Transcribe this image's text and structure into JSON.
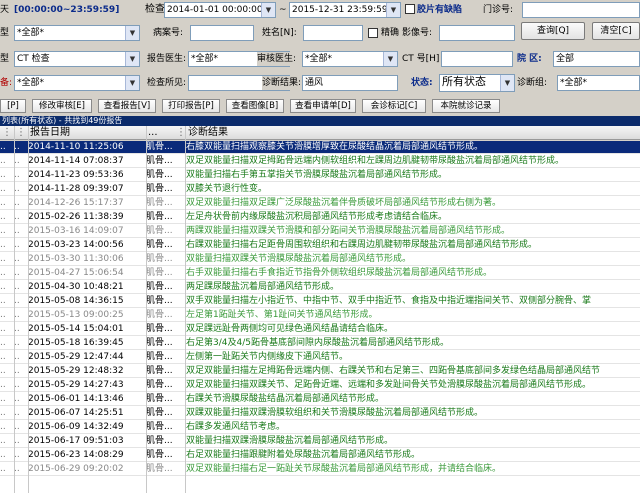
{
  "filters": {
    "row1": {
      "partial_label": "天",
      "time_range": "[00:00:00~23:59:59]",
      "check_time_label": "检查时间:",
      "date_from": "2014-01-01 00:00:00",
      "tilde": "~",
      "date_to": "2015-12-31 23:59:59",
      "film_label": "胶片有缺陷",
      "clinic_label": "门诊号:"
    },
    "row2": {
      "type_label": "型",
      "type_value": "*全部*",
      "case_label": "病案号:",
      "name_label": "姓名[N]:",
      "exact_label": "精确",
      "image_no_label": "影像号:",
      "query_button": "查询[Q]",
      "clear_button": "清空[C]"
    },
    "row3": {
      "type_label": "型",
      "type_value": "CT 检查",
      "report_doctor_label": "报告医生:",
      "report_doctor_value": "*全部*",
      "review_doctor_label": "审核医生:",
      "review_doctor_value": "*全部*",
      "ct_label": "CT 号[H]",
      "ward_label": "院 区:",
      "ward_value": "全部"
    },
    "row4": {
      "device_label": "备:",
      "device_value": "*全部*",
      "findings_label": "检查所见:",
      "diagnosis_label": "诊断结果:",
      "diagnosis_value": "通风",
      "status_label": "状态:",
      "status_value": "所有状态",
      "diag_group_label": "诊断组:",
      "diag_group_value": "*全部*"
    }
  },
  "toolbar": {
    "cut_label": "[P]",
    "buttons": [
      "修改审核[E]",
      "查看报告[V]",
      "打印报告[P]",
      "查看图像[B]",
      "查看申请单[D]",
      "会诊标记[C]",
      "本院就诊记录"
    ]
  },
  "status_text": "列表(所有状态) - 共找到49份报告",
  "table": {
    "col_date": "报告日期",
    "col_dots": "...",
    "col_diag": "诊断结果",
    "rows": [
      {
        "m1": "..",
        "m2": "..",
        "date": "2014-11-10 11:25:06",
        "part": "肌骨...",
        "diag": "右膝双能量扫描观察膝关节滑膜增厚致在尿酸结晶沉着局部通风结节形成。",
        "style": "sel"
      },
      {
        "m1": "..",
        "m2": "..",
        "date": "2014-11-14 07:08:37",
        "part": "肌骨...",
        "diag": "双足双能量扫描双足拇跖骨远端内侧软组织和左踝周边肌腱韧带尿酸盐沉着局部通风结节形成。",
        "style": ""
      },
      {
        "m1": "..",
        "m2": "..",
        "date": "2014-11-23 09:53:36",
        "part": "肌骨...",
        "diag": "双能量扫描右手第五掌指关节滑膜尿酸盐沉着局部通风结节形成。",
        "style": ""
      },
      {
        "m1": "..",
        "m2": "..",
        "date": "2014-11-28 09:39:07",
        "part": "肌骨...",
        "diag": "双膝关节退行性变。",
        "style": ""
      },
      {
        "m1": "..",
        "m2": "..",
        "date": "2014-12-26 15:17:37",
        "part": "肌骨...",
        "diag": "双足双能量扫描双足踝广泛尿酸盐沉着伴骨质破坏局部通风结节形成右侧为著。",
        "style": "gr gl"
      },
      {
        "m1": "..",
        "m2": "..",
        "date": "2015-02-26 11:38:39",
        "part": "肌骨...",
        "diag": "左足舟状骨前内缘尿酸盐沉积局部通风结节形成考虑请结合临床。",
        "style": ""
      },
      {
        "m1": "..",
        "m2": "..",
        "date": "2015-03-16 14:09:07",
        "part": "肌骨...",
        "diag": "两踝双能量扫描双踝关节滑膜和部分跖间关节滑膜尿酸盐沉着局部通风结节形成。",
        "style": "gr gl"
      },
      {
        "m1": "..",
        "m2": "..",
        "date": "2015-03-23 14:00:56",
        "part": "肌骨...",
        "diag": "右踝双能量扫描右足距骨周围软组织和右踝周边肌腱韧带尿酸盐沉着局部通风结节形成。",
        "style": ""
      },
      {
        "m1": "..",
        "m2": "..",
        "date": "2015-03-30 11:30:06",
        "part": "肌骨...",
        "diag": "双能量扫描双踝关节滑膜尿酸盐沉着局部通风结节形成。",
        "style": "gr gl"
      },
      {
        "m1": "..",
        "m2": "..",
        "date": "2015-04-27 15:06:54",
        "part": "肌骨...",
        "diag": "右手双能量扫描右手食指近节指骨外侧软组织尿酸盐沉着局部通风结节形成。",
        "style": "gr gl"
      },
      {
        "m1": "..",
        "m2": "..",
        "date": "2015-04-30 10:48:21",
        "part": "肌骨...",
        "diag": "两足踝尿酸盐沉着局部通风结节形成。",
        "style": ""
      },
      {
        "m1": "..",
        "m2": "..",
        "date": "2015-05-08 14:36:15",
        "part": "肌骨...",
        "diag": "双手双能量扫描左小指近节、中指中节、双手中指近节、食指及中指近端指间关节、双侧部分腕骨、掌",
        "style": ""
      },
      {
        "m1": "..",
        "m2": "..",
        "date": "2015-05-13 09:00:25",
        "part": "肌骨...",
        "diag": "左足第1跖趾关节、第1趾间关节通风结节形成。",
        "style": "gr gl"
      },
      {
        "m1": "..",
        "m2": "..",
        "date": "2015-05-14 15:04:01",
        "part": "肌骨...",
        "diag": "双足踝远趾骨两侧均可见绿色通风结晶请结合临床。",
        "style": ""
      },
      {
        "m1": "..",
        "m2": "..",
        "date": "2015-05-18 16:39:45",
        "part": "肌骨...",
        "diag": "右足第3/4及4/5跖骨基底部间隙内尿酸盐沉着局部通风结节形成。",
        "style": ""
      },
      {
        "m1": "..",
        "m2": "..",
        "date": "2015-05-29 12:47:44",
        "part": "肌骨...",
        "diag": "左侧第一趾跖关节内侧缘皮下通风结节。",
        "style": ""
      },
      {
        "m1": "..",
        "m2": "..",
        "date": "2015-05-29 12:48:32",
        "part": "肌骨...",
        "diag": "双足双能量扫描左足拇跖骨远端内侧、右踝关节和右足第三、四跖骨基底部间多发绿色结晶局部通风结节",
        "style": ""
      },
      {
        "m1": "..",
        "m2": "..",
        "date": "2015-05-29 14:27:43",
        "part": "肌骨...",
        "diag": "双足双能量扫描双踝关节、足跖骨近端、远端和多发趾间骨关节处滑膜尿酸盐沉着局部通风结节形成。",
        "style": ""
      },
      {
        "m1": "..",
        "m2": "..",
        "date": "2015-06-01 14:13:46",
        "part": "肌骨...",
        "diag": "右踝关节滑膜尿酸盐结晶沉着局部通风结节形成。",
        "style": ""
      },
      {
        "m1": "..",
        "m2": "..",
        "date": "2015-06-07 14:25:51",
        "part": "肌骨...",
        "diag": "双踝双能量扫描双踝滑膜软组织和关节滑膜尿酸盐沉着局部通风结节形成。",
        "style": ""
      },
      {
        "m1": "..",
        "m2": "..",
        "date": "2015-06-09 14:32:49",
        "part": "肌骨...",
        "diag": "右踝多发通风结节考虑。",
        "style": ""
      },
      {
        "m1": "..",
        "m2": "..",
        "date": "2015-06-17 09:51:03",
        "part": "肌骨...",
        "diag": "双能量扫描双踝滑膜尿酸盐沉着局部通风结节形成。",
        "style": ""
      },
      {
        "m1": "..",
        "m2": "..",
        "date": "2015-06-23 14:08:29",
        "part": "肌骨...",
        "diag": "右足双能量扫描跟腱附着处尿酸盐沉着局部通风结节形成。",
        "style": ""
      },
      {
        "m1": "..",
        "m2": "..",
        "date": "2015-06-29 09:20:02",
        "part": "肌骨...",
        "diag": "双足双能量扫描右足一跖趾关节尿酸盐沉着局部通风结节形成，并请结合临床。",
        "style": "gr gl"
      }
    ]
  }
}
